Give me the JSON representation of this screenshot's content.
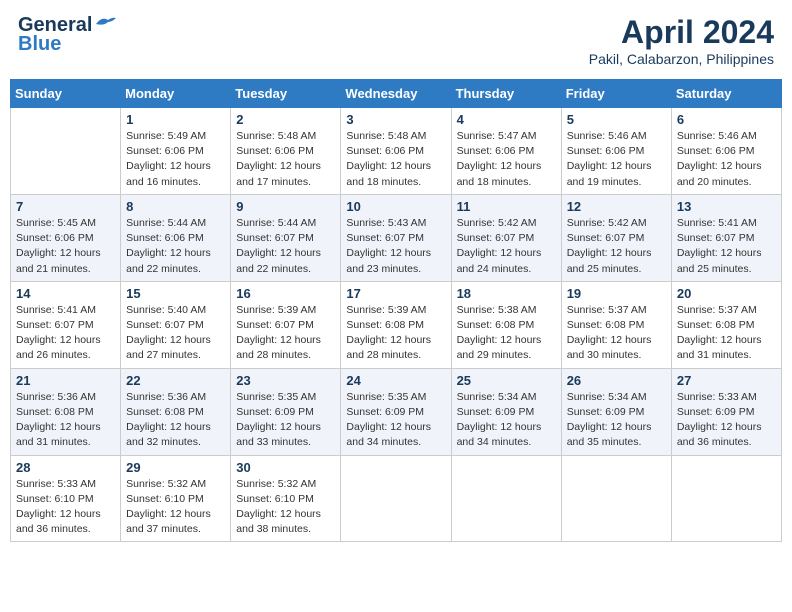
{
  "header": {
    "logo_general": "General",
    "logo_blue": "Blue",
    "month_title": "April 2024",
    "location": "Pakil, Calabarzon, Philippines"
  },
  "days_of_week": [
    "Sunday",
    "Monday",
    "Tuesday",
    "Wednesday",
    "Thursday",
    "Friday",
    "Saturday"
  ],
  "weeks": [
    [
      {
        "day": "",
        "info": ""
      },
      {
        "day": "1",
        "info": "Sunrise: 5:49 AM\nSunset: 6:06 PM\nDaylight: 12 hours\nand 16 minutes."
      },
      {
        "day": "2",
        "info": "Sunrise: 5:48 AM\nSunset: 6:06 PM\nDaylight: 12 hours\nand 17 minutes."
      },
      {
        "day": "3",
        "info": "Sunrise: 5:48 AM\nSunset: 6:06 PM\nDaylight: 12 hours\nand 18 minutes."
      },
      {
        "day": "4",
        "info": "Sunrise: 5:47 AM\nSunset: 6:06 PM\nDaylight: 12 hours\nand 18 minutes."
      },
      {
        "day": "5",
        "info": "Sunrise: 5:46 AM\nSunset: 6:06 PM\nDaylight: 12 hours\nand 19 minutes."
      },
      {
        "day": "6",
        "info": "Sunrise: 5:46 AM\nSunset: 6:06 PM\nDaylight: 12 hours\nand 20 minutes."
      }
    ],
    [
      {
        "day": "7",
        "info": "Sunrise: 5:45 AM\nSunset: 6:06 PM\nDaylight: 12 hours\nand 21 minutes."
      },
      {
        "day": "8",
        "info": "Sunrise: 5:44 AM\nSunset: 6:06 PM\nDaylight: 12 hours\nand 22 minutes."
      },
      {
        "day": "9",
        "info": "Sunrise: 5:44 AM\nSunset: 6:07 PM\nDaylight: 12 hours\nand 22 minutes."
      },
      {
        "day": "10",
        "info": "Sunrise: 5:43 AM\nSunset: 6:07 PM\nDaylight: 12 hours\nand 23 minutes."
      },
      {
        "day": "11",
        "info": "Sunrise: 5:42 AM\nSunset: 6:07 PM\nDaylight: 12 hours\nand 24 minutes."
      },
      {
        "day": "12",
        "info": "Sunrise: 5:42 AM\nSunset: 6:07 PM\nDaylight: 12 hours\nand 25 minutes."
      },
      {
        "day": "13",
        "info": "Sunrise: 5:41 AM\nSunset: 6:07 PM\nDaylight: 12 hours\nand 25 minutes."
      }
    ],
    [
      {
        "day": "14",
        "info": "Sunrise: 5:41 AM\nSunset: 6:07 PM\nDaylight: 12 hours\nand 26 minutes."
      },
      {
        "day": "15",
        "info": "Sunrise: 5:40 AM\nSunset: 6:07 PM\nDaylight: 12 hours\nand 27 minutes."
      },
      {
        "day": "16",
        "info": "Sunrise: 5:39 AM\nSunset: 6:07 PM\nDaylight: 12 hours\nand 28 minutes."
      },
      {
        "day": "17",
        "info": "Sunrise: 5:39 AM\nSunset: 6:08 PM\nDaylight: 12 hours\nand 28 minutes."
      },
      {
        "day": "18",
        "info": "Sunrise: 5:38 AM\nSunset: 6:08 PM\nDaylight: 12 hours\nand 29 minutes."
      },
      {
        "day": "19",
        "info": "Sunrise: 5:37 AM\nSunset: 6:08 PM\nDaylight: 12 hours\nand 30 minutes."
      },
      {
        "day": "20",
        "info": "Sunrise: 5:37 AM\nSunset: 6:08 PM\nDaylight: 12 hours\nand 31 minutes."
      }
    ],
    [
      {
        "day": "21",
        "info": "Sunrise: 5:36 AM\nSunset: 6:08 PM\nDaylight: 12 hours\nand 31 minutes."
      },
      {
        "day": "22",
        "info": "Sunrise: 5:36 AM\nSunset: 6:08 PM\nDaylight: 12 hours\nand 32 minutes."
      },
      {
        "day": "23",
        "info": "Sunrise: 5:35 AM\nSunset: 6:09 PM\nDaylight: 12 hours\nand 33 minutes."
      },
      {
        "day": "24",
        "info": "Sunrise: 5:35 AM\nSunset: 6:09 PM\nDaylight: 12 hours\nand 34 minutes."
      },
      {
        "day": "25",
        "info": "Sunrise: 5:34 AM\nSunset: 6:09 PM\nDaylight: 12 hours\nand 34 minutes."
      },
      {
        "day": "26",
        "info": "Sunrise: 5:34 AM\nSunset: 6:09 PM\nDaylight: 12 hours\nand 35 minutes."
      },
      {
        "day": "27",
        "info": "Sunrise: 5:33 AM\nSunset: 6:09 PM\nDaylight: 12 hours\nand 36 minutes."
      }
    ],
    [
      {
        "day": "28",
        "info": "Sunrise: 5:33 AM\nSunset: 6:10 PM\nDaylight: 12 hours\nand 36 minutes."
      },
      {
        "day": "29",
        "info": "Sunrise: 5:32 AM\nSunset: 6:10 PM\nDaylight: 12 hours\nand 37 minutes."
      },
      {
        "day": "30",
        "info": "Sunrise: 5:32 AM\nSunset: 6:10 PM\nDaylight: 12 hours\nand 38 minutes."
      },
      {
        "day": "",
        "info": ""
      },
      {
        "day": "",
        "info": ""
      },
      {
        "day": "",
        "info": ""
      },
      {
        "day": "",
        "info": ""
      }
    ]
  ]
}
